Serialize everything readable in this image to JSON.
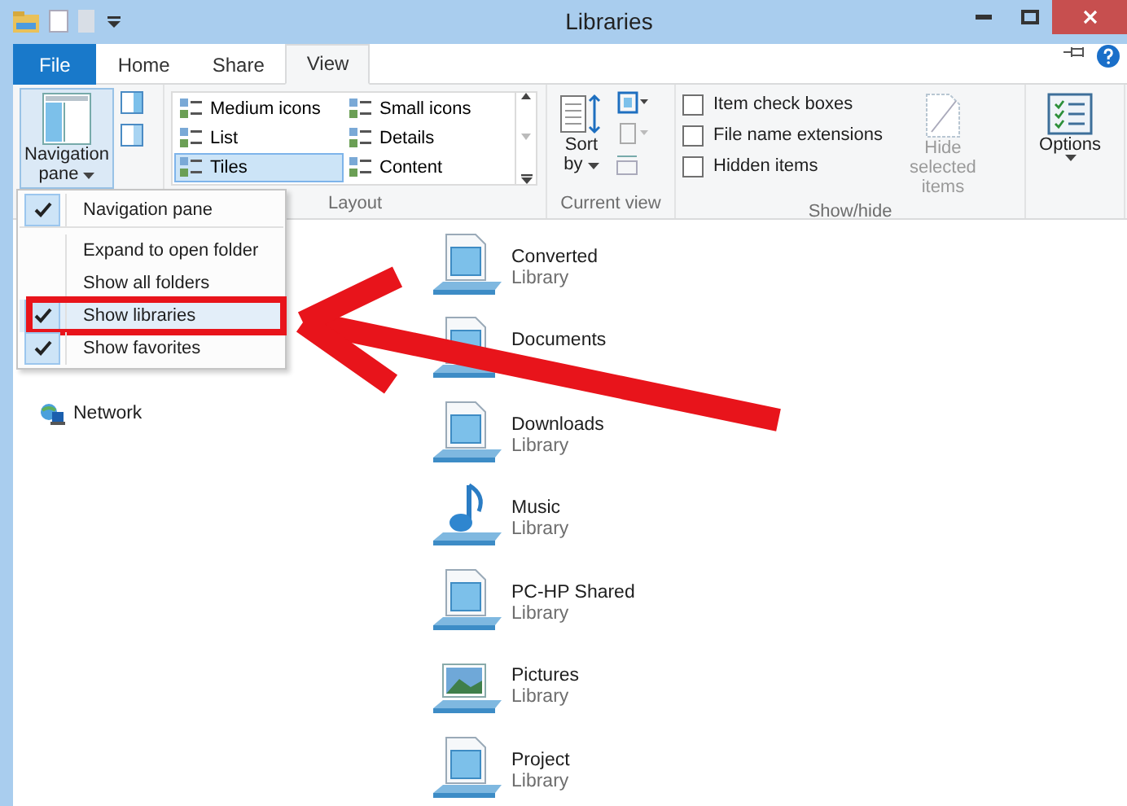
{
  "window": {
    "title": "Libraries"
  },
  "ribbon_tabs": [
    {
      "label": "File",
      "kind": "file",
      "selected": false
    },
    {
      "label": "Home",
      "kind": "tab",
      "selected": false
    },
    {
      "label": "Share",
      "kind": "tab",
      "selected": false
    },
    {
      "label": "View",
      "kind": "tab",
      "selected": true
    }
  ],
  "ribbon": {
    "navigation_button": "Navigation pane",
    "layout": {
      "label": "Layout",
      "options": [
        {
          "label": "Medium icons",
          "selected": false
        },
        {
          "label": "Small icons",
          "selected": false
        },
        {
          "label": "List",
          "selected": false
        },
        {
          "label": "Details",
          "selected": false
        },
        {
          "label": "Tiles",
          "selected": true
        },
        {
          "label": "Content",
          "selected": false
        }
      ]
    },
    "current_view": {
      "label": "Current view",
      "sort_button": "Sort by"
    },
    "show_hide": {
      "label": "Show/hide",
      "checkboxes": [
        {
          "label": "Item check boxes",
          "checked": false
        },
        {
          "label": "File name extensions",
          "checked": false
        },
        {
          "label": "Hidden items",
          "checked": false
        }
      ],
      "hide_button": {
        "label": "Hide selected items",
        "disabled": true
      }
    },
    "options_button": "Options"
  },
  "navigation_menu": [
    {
      "label": "Navigation pane",
      "checked": true,
      "highlighted": false
    },
    {
      "label": "Expand to open folder",
      "checked": false,
      "highlighted": false
    },
    {
      "label": "Show all folders",
      "checked": false,
      "highlighted": false
    },
    {
      "label": "Show libraries",
      "checked": true,
      "highlighted": true
    },
    {
      "label": "Show favorites",
      "checked": true,
      "highlighted": false
    }
  ],
  "nav_pane": [
    {
      "label": "Network"
    }
  ],
  "libraries": [
    {
      "name": "Converted",
      "type": "Library",
      "kind": "document"
    },
    {
      "name": "Documents",
      "kind": "document"
    },
    {
      "name": "Downloads",
      "type": "Library",
      "kind": "document"
    },
    {
      "name": "Music",
      "type": "Library",
      "kind": "music"
    },
    {
      "name": "PC-HP Shared",
      "type": "Library",
      "kind": "document"
    },
    {
      "name": "Pictures",
      "type": "Library",
      "kind": "picture"
    },
    {
      "name": "Project",
      "type": "Library",
      "kind": "document"
    }
  ]
}
